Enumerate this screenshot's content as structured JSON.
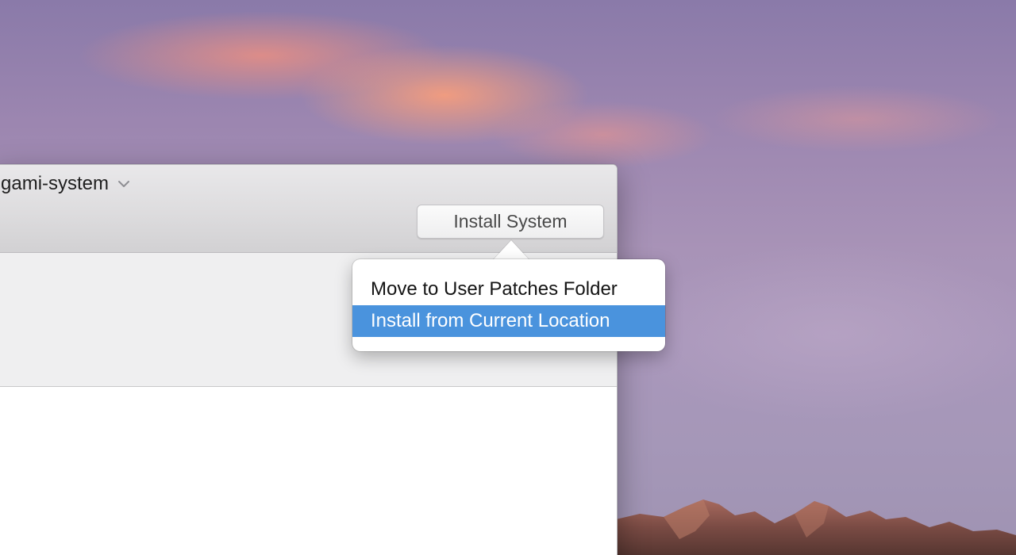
{
  "window": {
    "title": "gami-system",
    "title_icon": "chevron-down-icon"
  },
  "toolbar": {
    "install_button_label": "Install System"
  },
  "popover_menu": {
    "items": [
      {
        "label": "Move to User Patches Folder",
        "selected": false
      },
      {
        "label": "Install from Current Location",
        "selected": true
      }
    ],
    "highlight_color": "#4a93dd"
  },
  "desktop": {
    "wallpaper": "sierra-sunset-mountains"
  }
}
